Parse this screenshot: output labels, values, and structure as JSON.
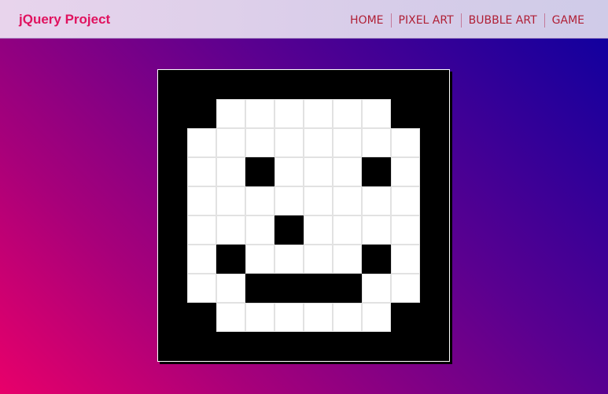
{
  "app": {
    "brand": "jQuery Project"
  },
  "nav": {
    "items": [
      {
        "label": "HOME"
      },
      {
        "label": "PIXEL ART"
      },
      {
        "label": "BUBBLE ART"
      },
      {
        "label": "GAME"
      }
    ]
  },
  "colors": {
    "brand": "#e0125f",
    "nav_link": "#b02036",
    "pixel_on": "#ffffff",
    "pixel_off": "#000000"
  },
  "pixel_art": {
    "rows": 10,
    "cols": 10,
    "grid": [
      "0000000000",
      "0011111100",
      "0111111110",
      "0110111010",
      "0111111110",
      "0111011110",
      "0101111010",
      "0110000110",
      "0011111100",
      "0000000000"
    ]
  }
}
